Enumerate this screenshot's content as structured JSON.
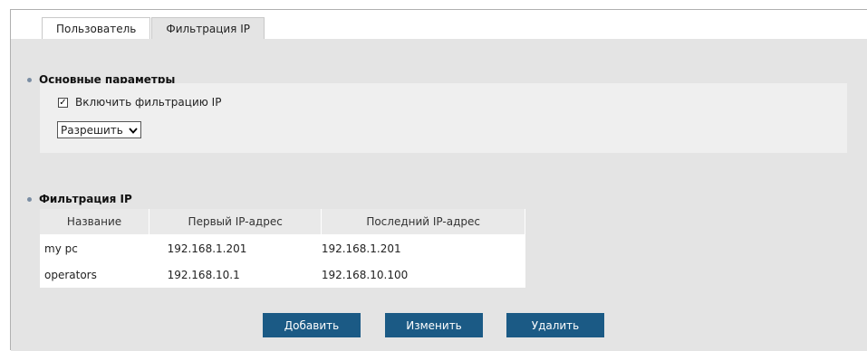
{
  "tabs": [
    {
      "label": "Пользователь",
      "active": false
    },
    {
      "label": "Фильтрация IP",
      "active": true
    }
  ],
  "main_params": {
    "title": "Основные параметры",
    "enable_filter_label": "Включить фильтрацию IP",
    "enable_filter_checked": true,
    "mode_select_value": "Разрешить"
  },
  "ip_filter": {
    "title": "Фильтрация IP",
    "columns": [
      "Название",
      "Первый IP-адрес",
      "Последний IP-адрес"
    ],
    "rows": [
      {
        "name": "my pc",
        "first_ip": "192.168.1.201",
        "last_ip": "192.168.1.201"
      },
      {
        "name": "operators",
        "first_ip": "192.168.10.1",
        "last_ip": "192.168.10.100"
      }
    ]
  },
  "actions": {
    "add_label": "Добавить",
    "edit_label": "Изменить",
    "delete_label": "Удалить"
  },
  "colors": {
    "panel_bg": "#e4e4e4",
    "inner_panel_bg": "#efefef",
    "button_bg": "#1b5a85",
    "bullet": "#7a8da3"
  },
  "icons": {
    "checkbox": "check-mark",
    "select_arrow": "chevron-down-icon",
    "section_bullet": "dot-icon"
  }
}
